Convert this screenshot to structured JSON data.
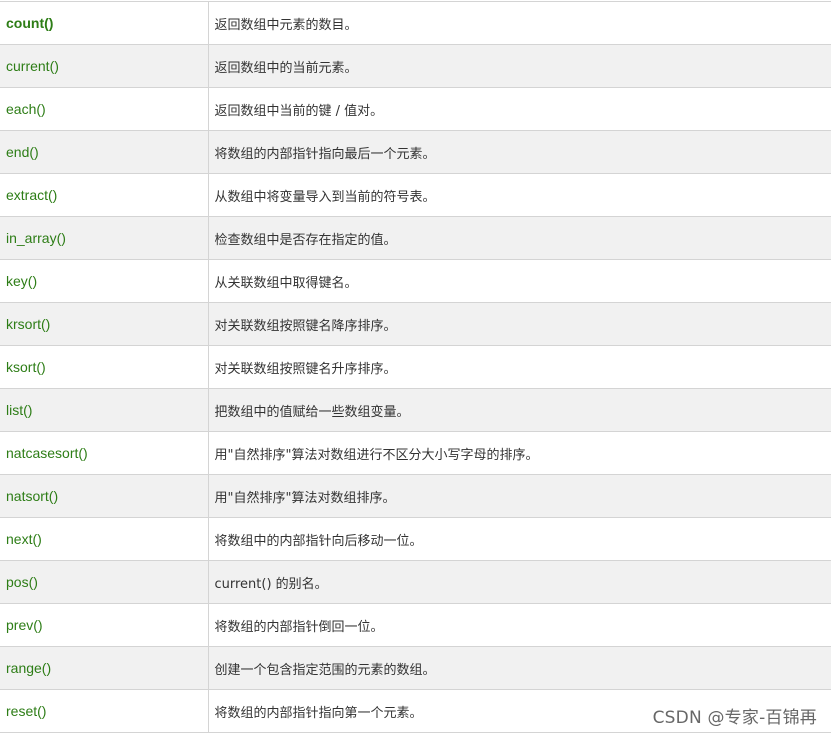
{
  "functions": [
    {
      "name": "count()",
      "desc": "返回数组中元素的数目。"
    },
    {
      "name": "current()",
      "desc": "返回数组中的当前元素。"
    },
    {
      "name": "each()",
      "desc": "返回数组中当前的键 / 值对。"
    },
    {
      "name": "end()",
      "desc": "将数组的内部指针指向最后一个元素。"
    },
    {
      "name": "extract()",
      "desc": "从数组中将变量导入到当前的符号表。"
    },
    {
      "name": "in_array()",
      "desc": "检查数组中是否存在指定的值。"
    },
    {
      "name": "key()",
      "desc": "从关联数组中取得键名。"
    },
    {
      "name": "krsort()",
      "desc": "对关联数组按照键名降序排序。"
    },
    {
      "name": "ksort()",
      "desc": "对关联数组按照键名升序排序。"
    },
    {
      "name": "list()",
      "desc": "把数组中的值赋给一些数组变量。"
    },
    {
      "name": "natcasesort()",
      "desc": "用\"自然排序\"算法对数组进行不区分大小写字母的排序。"
    },
    {
      "name": "natsort()",
      "desc": "用\"自然排序\"算法对数组排序。"
    },
    {
      "name": "next()",
      "desc": "将数组中的内部指针向后移动一位。"
    },
    {
      "name": "pos()",
      "desc": "current() 的别名。"
    },
    {
      "name": "prev()",
      "desc": "将数组的内部指针倒回一位。"
    },
    {
      "name": "range()",
      "desc": "创建一个包含指定范围的元素的数组。"
    },
    {
      "name": "reset()",
      "desc": "将数组的内部指针指向第一个元素。"
    }
  ],
  "watermark": "CSDN @专家-百锦再",
  "colors": {
    "function_name": "#2d7d16",
    "description": "#333333",
    "row_alt": "#f1f1f1",
    "border": "#d4d4d4"
  }
}
